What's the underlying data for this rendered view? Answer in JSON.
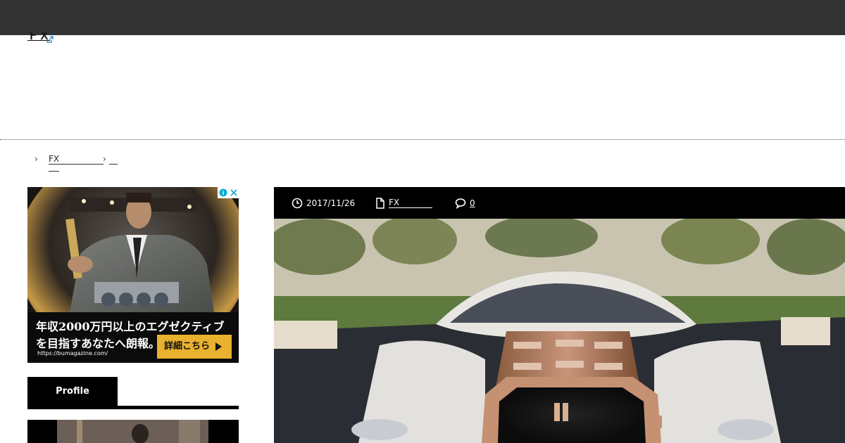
{
  "header": {
    "site_title": "ＦＸ"
  },
  "breadcrumb": {
    "sep": "›",
    "items": [
      "FX"
    ]
  },
  "ad": {
    "headline_line1": "年収2000万円以上のエグゼクティブ",
    "headline_line2": "を目指すあなたへ朗報。",
    "url": "https://bumagazine.com/",
    "cta_label": "詳細こちら",
    "info_icon": "info-icon",
    "close_icon": "close-icon",
    "cta_color": "#e8b12e"
  },
  "sidebar": {
    "profile_title": "Profile"
  },
  "article": {
    "date": "2017/11/26",
    "category": "FX",
    "comment_count": "0",
    "icons": [
      "clock-icon",
      "file-icon",
      "comment-icon"
    ]
  },
  "colors": {
    "topbar": "#333333",
    "meta_bar": "#000000",
    "accent": "#e8b12e"
  }
}
